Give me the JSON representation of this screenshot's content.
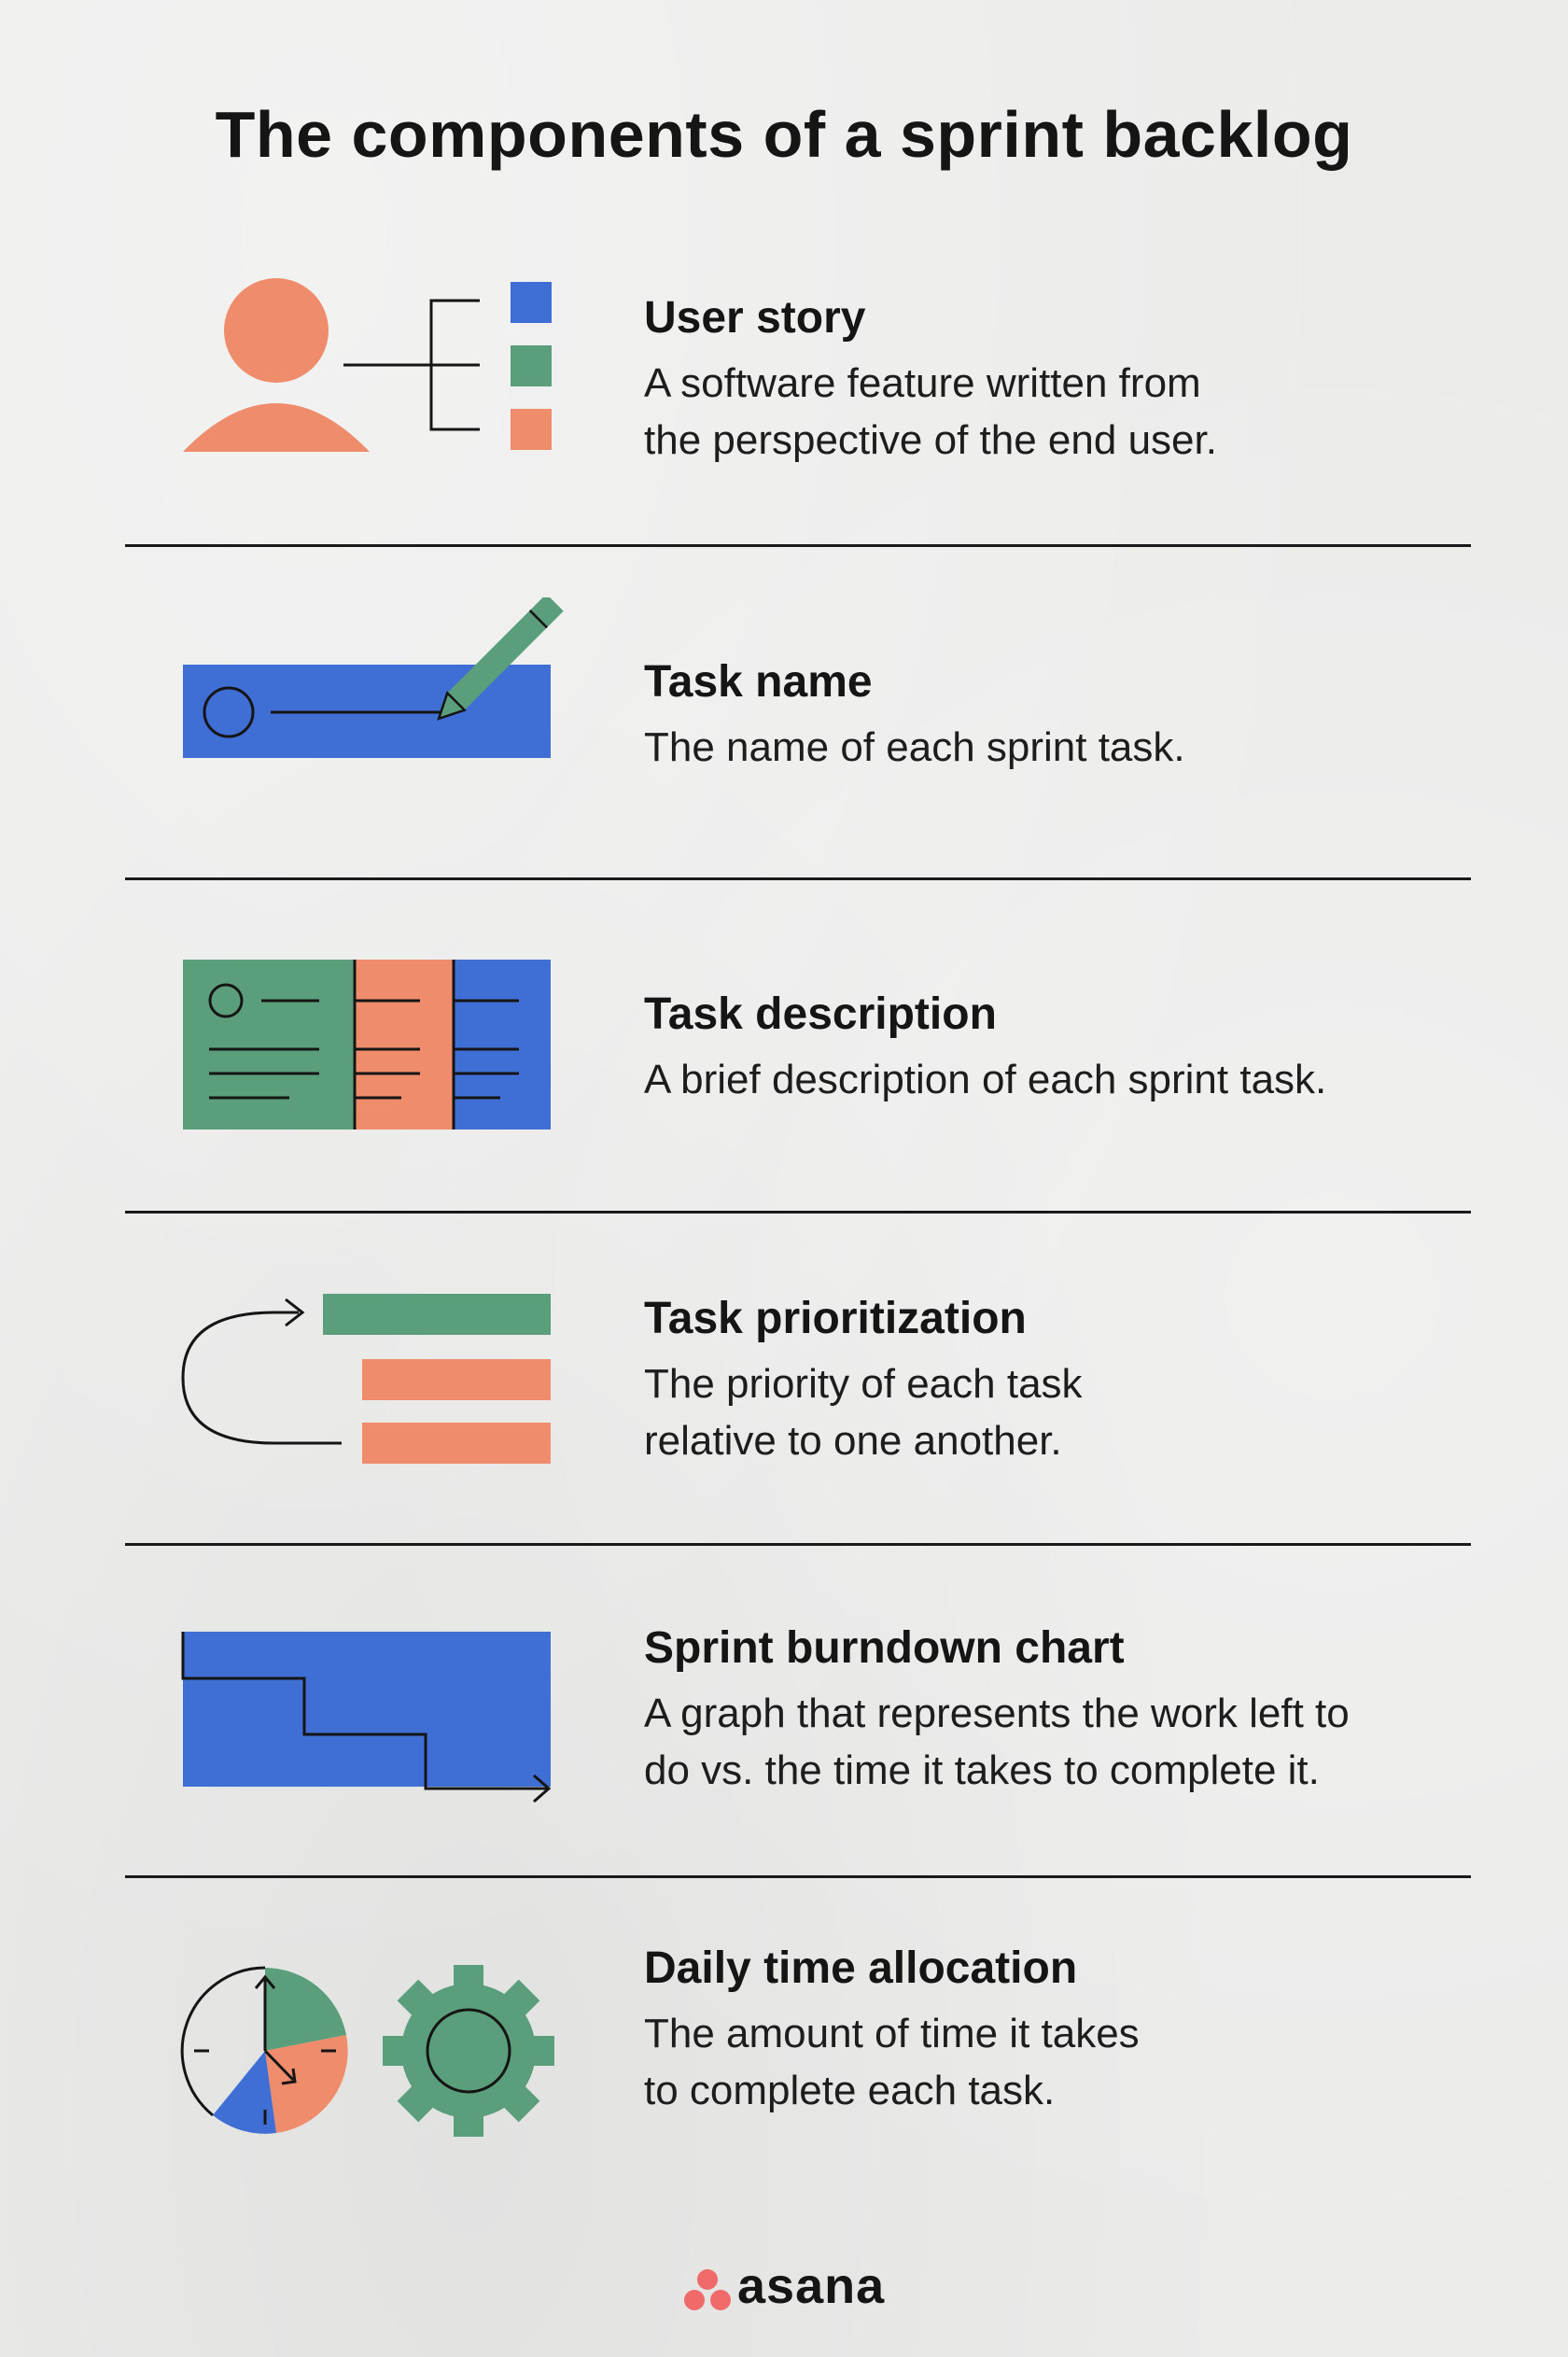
{
  "title": "The components of a sprint backlog",
  "items": [
    {
      "icon": "user-story-icon",
      "title": "User story",
      "description_lines": [
        "A software feature written from",
        "the perspective of the end user."
      ]
    },
    {
      "icon": "task-name-icon",
      "title": "Task name",
      "description_lines": [
        "The name of each sprint task."
      ]
    },
    {
      "icon": "task-description-icon",
      "title": "Task description",
      "description_lines": [
        "A brief description of each sprint task."
      ]
    },
    {
      "icon": "task-prioritization-icon",
      "title": "Task prioritization",
      "description_lines": [
        "The priority of each task",
        "relative to one another."
      ]
    },
    {
      "icon": "burndown-chart-icon",
      "title": "Sprint burndown chart",
      "description_lines": [
        "A graph that represents the work left to",
        "do vs. the time it takes to complete it."
      ]
    },
    {
      "icon": "time-allocation-icon",
      "title": "Daily time allocation",
      "description_lines": [
        "The amount of time it takes",
        "to complete each task."
      ]
    }
  ],
  "brand": {
    "name": "asana",
    "logo": "asana-logo"
  },
  "colors": {
    "coral": "#ef8c6b",
    "green": "#5a9e7b",
    "blue": "#3f6fd4",
    "ink": "#151515",
    "background": "#ebebea"
  }
}
